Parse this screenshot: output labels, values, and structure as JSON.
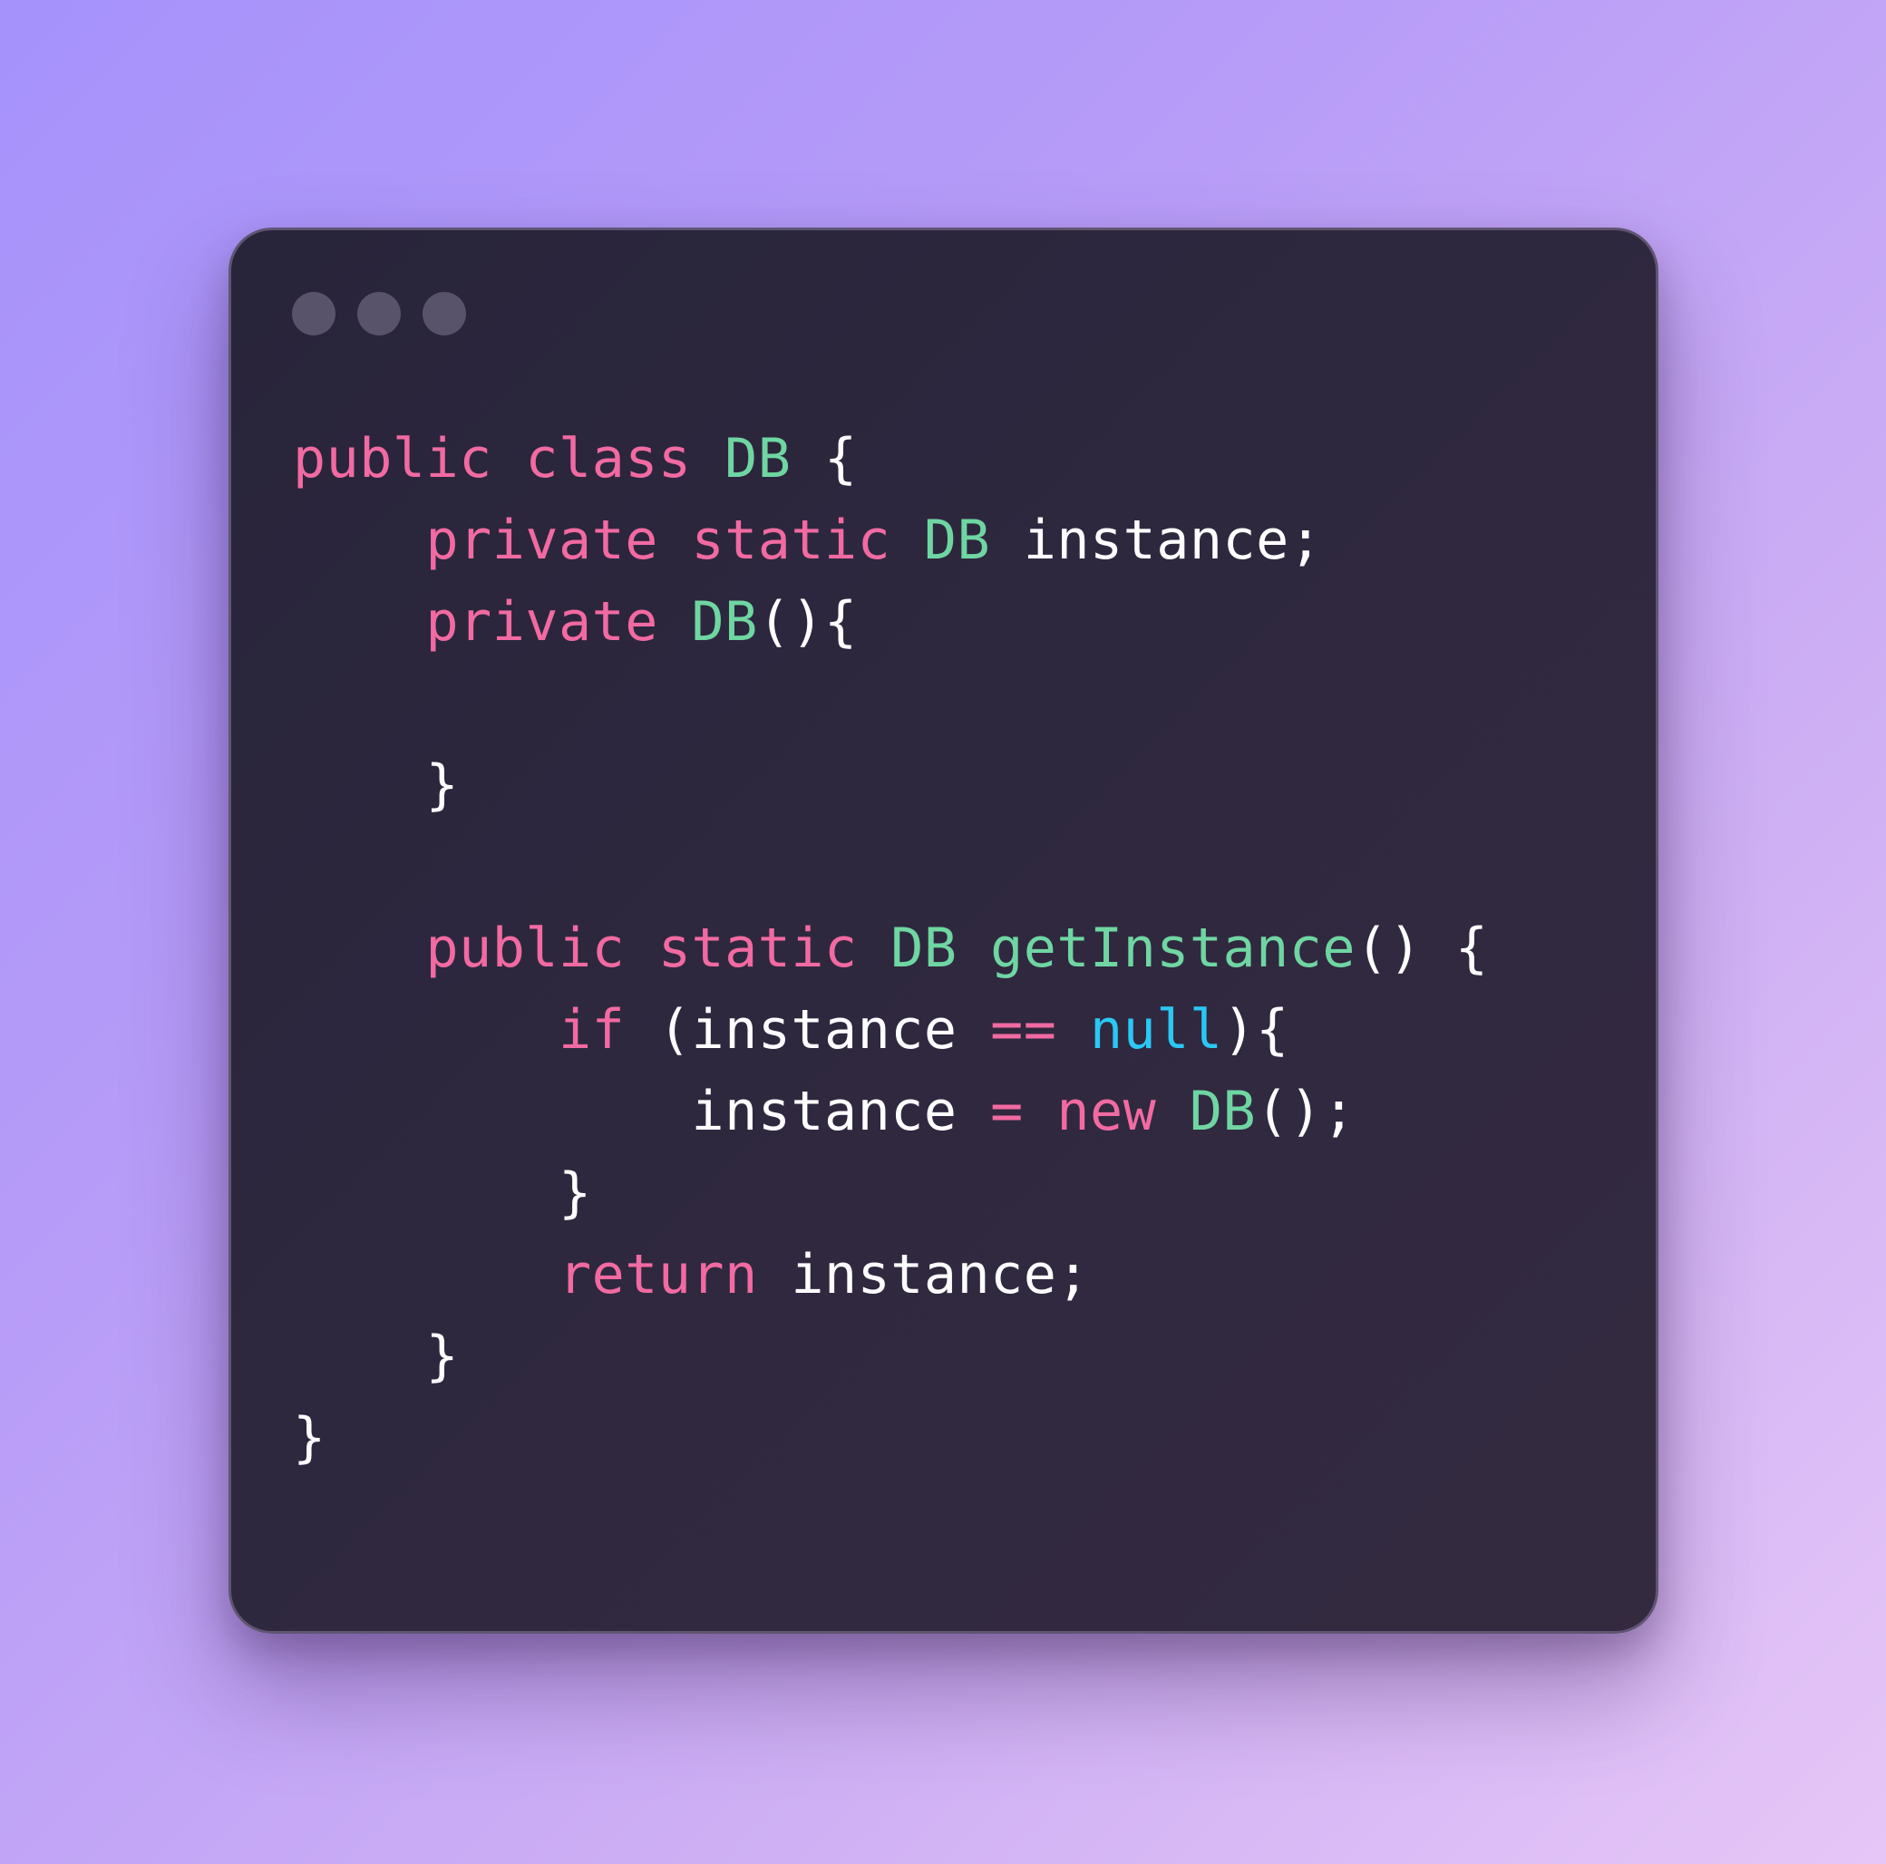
{
  "window": {
    "controls": [
      "dot",
      "dot",
      "dot"
    ]
  },
  "code": {
    "language": "java",
    "lines": [
      [
        {
          "t": "public",
          "k": "kw"
        },
        {
          "t": " ",
          "k": "pn"
        },
        {
          "t": "class",
          "k": "kw"
        },
        {
          "t": " ",
          "k": "pn"
        },
        {
          "t": "DB",
          "k": "ty"
        },
        {
          "t": " {",
          "k": "pn"
        }
      ],
      [
        {
          "t": "    ",
          "k": "pn"
        },
        {
          "t": "private",
          "k": "kw"
        },
        {
          "t": " ",
          "k": "pn"
        },
        {
          "t": "static",
          "k": "kw"
        },
        {
          "t": " ",
          "k": "pn"
        },
        {
          "t": "DB",
          "k": "ty"
        },
        {
          "t": " ",
          "k": "pn"
        },
        {
          "t": "instance",
          "k": "id"
        },
        {
          "t": ";",
          "k": "pn"
        }
      ],
      [
        {
          "t": "    ",
          "k": "pn"
        },
        {
          "t": "private",
          "k": "kw"
        },
        {
          "t": " ",
          "k": "pn"
        },
        {
          "t": "DB",
          "k": "ty"
        },
        {
          "t": "(){",
          "k": "pn"
        }
      ],
      [],
      [
        {
          "t": "    }",
          "k": "pn"
        }
      ],
      [],
      [
        {
          "t": "    ",
          "k": "pn"
        },
        {
          "t": "public",
          "k": "kw"
        },
        {
          "t": " ",
          "k": "pn"
        },
        {
          "t": "static",
          "k": "kw"
        },
        {
          "t": " ",
          "k": "pn"
        },
        {
          "t": "DB",
          "k": "ty"
        },
        {
          "t": " ",
          "k": "pn"
        },
        {
          "t": "getInstance",
          "k": "fn"
        },
        {
          "t": "() {",
          "k": "pn"
        }
      ],
      [
        {
          "t": "        ",
          "k": "pn"
        },
        {
          "t": "if",
          "k": "kw"
        },
        {
          "t": " (",
          "k": "pn"
        },
        {
          "t": "instance",
          "k": "id"
        },
        {
          "t": " ",
          "k": "pn"
        },
        {
          "t": "==",
          "k": "op"
        },
        {
          "t": " ",
          "k": "pn"
        },
        {
          "t": "null",
          "k": "nl"
        },
        {
          "t": "){",
          "k": "pn"
        }
      ],
      [
        {
          "t": "            ",
          "k": "pn"
        },
        {
          "t": "instance",
          "k": "id"
        },
        {
          "t": " ",
          "k": "pn"
        },
        {
          "t": "=",
          "k": "op"
        },
        {
          "t": " ",
          "k": "pn"
        },
        {
          "t": "new",
          "k": "kw"
        },
        {
          "t": " ",
          "k": "pn"
        },
        {
          "t": "DB",
          "k": "ty"
        },
        {
          "t": "();",
          "k": "pn"
        }
      ],
      [
        {
          "t": "        }",
          "k": "pn"
        }
      ],
      [
        {
          "t": "        ",
          "k": "pn"
        },
        {
          "t": "return",
          "k": "kw"
        },
        {
          "t": " ",
          "k": "pn"
        },
        {
          "t": "instance",
          "k": "id"
        },
        {
          "t": ";",
          "k": "pn"
        }
      ],
      [
        {
          "t": "    }",
          "k": "pn"
        }
      ],
      [
        {
          "t": "}",
          "k": "pn"
        }
      ]
    ]
  },
  "colors": {
    "keyword": "#f26aa2",
    "type": "#6fd6a2",
    "null": "#2ac8f5",
    "text": "#ffffff",
    "window_bg": "#2e283f",
    "control_dot": "#58526a"
  }
}
